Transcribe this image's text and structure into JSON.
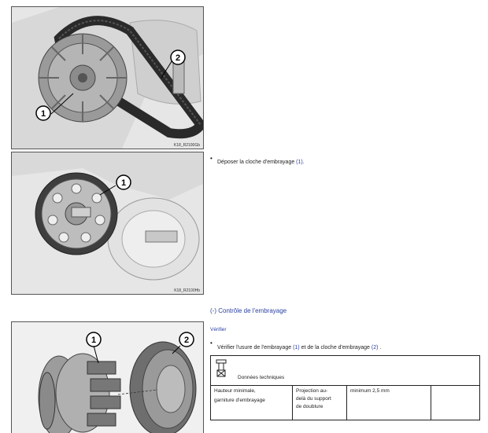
{
  "figures": [
    {
      "caption": "K18_R2100Gb",
      "callouts": [
        "1",
        "2"
      ]
    },
    {
      "caption": "K18_R2100Hb",
      "callouts": [
        "1"
      ]
    },
    {
      "caption": "",
      "callouts": [
        "1",
        "2"
      ]
    }
  ],
  "step1": {
    "bullet": "•",
    "text_before": "Déposer la cloche d'embrayage ",
    "ref": "(1)",
    "text_after": "."
  },
  "section": {
    "heading": "(-) Contrôle de l'embrayage",
    "subheading": "Vérifier"
  },
  "step2": {
    "bullet": "•",
    "text_before": "Vérifier l'usure de l'embrayage ",
    "ref1": "(1)",
    "text_middle": " et de la cloche d'embrayage ",
    "ref2": "(2)",
    "text_after": " ."
  },
  "tech_table": {
    "header": "Données techniques",
    "row": {
      "label_line1": "Hauteur minimale,",
      "label_line2": "garniture d'embrayage",
      "desc_line1": "Projection au-",
      "desc_line2": "delà du support",
      "desc_line3": "de doublure",
      "value": "minimum 2,5 mm"
    }
  }
}
